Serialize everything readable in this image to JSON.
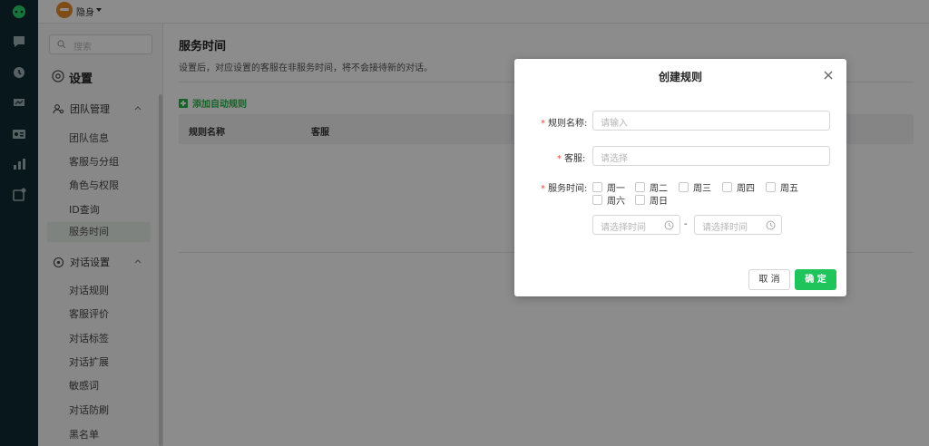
{
  "topbar": {
    "status_label": "隐身"
  },
  "sidebar": {
    "search_placeholder": "搜索",
    "settings_title": "设置",
    "groups": [
      {
        "label": "团队管理",
        "items": [
          "团队信息",
          "客服与分组",
          "角色与权限",
          "ID查询",
          "服务时间"
        ]
      },
      {
        "label": "对话设置",
        "items": [
          "对话规则",
          "客服评价",
          "对话标签",
          "对话扩展",
          "敏感词",
          "对话防刷",
          "黑名单"
        ]
      }
    ],
    "active_item": "服务时间"
  },
  "main": {
    "title": "服务时间",
    "description": "设置后，对应设置的客服在非服务时间，将不会接待新的对话。",
    "add_rule_label": "添加自动规则",
    "table_headers": [
      "规则名称",
      "客服"
    ]
  },
  "modal": {
    "title": "创建规则",
    "rule_name_label": "规则名称:",
    "rule_name_placeholder": "请输入",
    "agent_label": "客服:",
    "agent_placeholder": "请选择",
    "service_time_label": "服务时间:",
    "weekdays": [
      "周一",
      "周二",
      "周三",
      "周四",
      "周五",
      "周六",
      "周日"
    ],
    "start_time_placeholder": "请选择时间",
    "end_time_placeholder": "请选择时间",
    "range_separator": "-",
    "cancel_label": "取 消",
    "confirm_label": "确 定"
  },
  "colors": {
    "rail": "#0e2a33",
    "accent_green": "#1fc45a",
    "required_red": "#e74c3c"
  }
}
